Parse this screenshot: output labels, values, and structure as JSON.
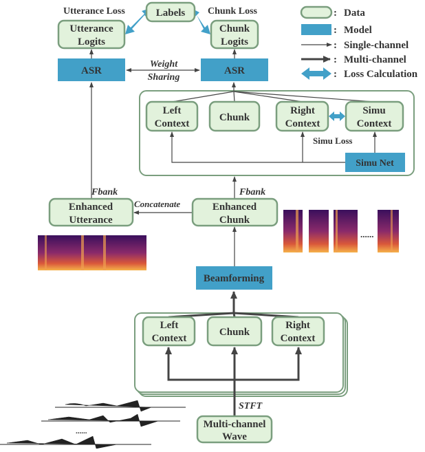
{
  "legend": {
    "items": [
      {
        "symbol": "data-rounded-box",
        "label": "Data"
      },
      {
        "symbol": "model-box",
        "label": "Model"
      },
      {
        "symbol": "thin-arrow",
        "label": "Single-channel"
      },
      {
        "symbol": "thick-arrow",
        "label": "Multi-channel"
      },
      {
        "symbol": "double-arrow",
        "label": "Loss Calculation"
      }
    ],
    "separator": ":"
  },
  "nodes": {
    "labels": "Labels",
    "utterance_logits": [
      "Utterance",
      "Logits"
    ],
    "chunk_logits": [
      "Chunk",
      "Logits"
    ],
    "asr_left": "ASR",
    "asr_right": "ASR",
    "left_context": [
      "Left",
      "Context"
    ],
    "chunk": "Chunk",
    "right_context": [
      "Right",
      "Context"
    ],
    "simu_context": [
      "Simu",
      "Context"
    ],
    "simu_net": "Simu Net",
    "enhanced_utterance": [
      "Enhanced",
      "Utterance"
    ],
    "enhanced_chunk": [
      "Enhanced",
      "Chunk"
    ],
    "beamforming": "Beamforming",
    "lower_left_context": [
      "Left",
      "Context"
    ],
    "lower_chunk": "Chunk",
    "lower_right_context": [
      "Right",
      "Context"
    ],
    "multichannel_wave": [
      "Multi-channel",
      "Wave"
    ]
  },
  "edge_labels": {
    "utterance_loss": "Utterance Loss",
    "chunk_loss": "Chunk Loss",
    "weight_sharing": [
      "Weight",
      "Sharing"
    ],
    "simu_loss": "Simu Loss",
    "fbank_left": "Fbank",
    "fbank_right": "Fbank",
    "concatenate": "Concatenate",
    "stft": "STFT",
    "ellipsis": "......"
  },
  "colors": {
    "data_fill": "#e2f2dc",
    "data_border": "#7a9e7e",
    "model": "#42a0c8",
    "arrow": "#444444"
  }
}
